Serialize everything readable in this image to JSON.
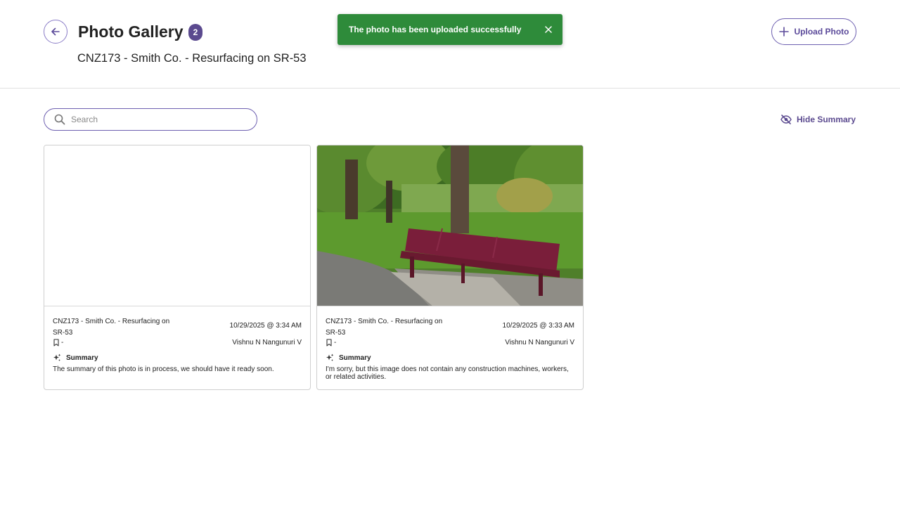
{
  "header": {
    "title": "Photo Gallery",
    "count": "2",
    "subtitle": "CNZ173 - Smith Co. - Resurfacing on SR-53",
    "upload_label": "Upload Photo"
  },
  "toast": {
    "message": "The photo has been uploaded successfully",
    "color": "#2e8b3a"
  },
  "search": {
    "placeholder": "Search",
    "value": ""
  },
  "summary_toggle": {
    "label": "Hide Summary"
  },
  "colors": {
    "accent": "#5b4a8f",
    "border": "#6d5fb0"
  },
  "icons": {
    "back": "arrow-left-icon",
    "close": "close-icon",
    "upload": "plus-icon",
    "search": "search-icon",
    "hide": "eye-off-icon",
    "tag": "bookmark-icon",
    "summary": "sparkle-icon"
  },
  "photos": [
    {
      "project": "CNZ173 - Smith Co. - Resurfacing on SR-53",
      "datetime": "10/29/2025 @ 3:34 AM",
      "tag": "-",
      "author": "Vishnu N Nangunuri V",
      "summary_title": "Summary",
      "summary_text": "The summary of this photo is in process, we should have it ready soon.",
      "image": "blank"
    },
    {
      "project": "CNZ173 - Smith Co. - Resurfacing on SR-53",
      "datetime": "10/29/2025 @ 3:33 AM",
      "tag": "-",
      "author": "Vishnu N Nangunuri V",
      "summary_title": "Summary",
      "summary_text": "I'm sorry, but this image does not contain any construction machines, workers, or related activities.",
      "image": "park-bench-photo"
    }
  ]
}
